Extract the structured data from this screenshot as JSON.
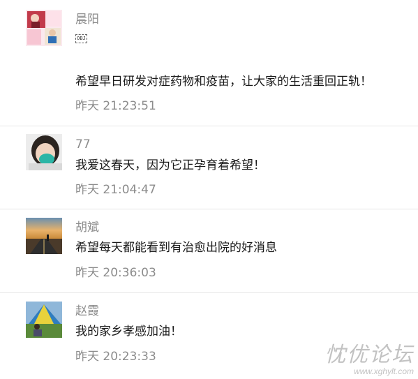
{
  "comments": [
    {
      "name": "晨阳",
      "emoji_glyph": "OBJ",
      "text": "希望早日研发对症药物和疫苗，让大家的生活重回正轨！",
      "time": "昨天 21:23:51",
      "avatar_icon": "collage-photo-avatar"
    },
    {
      "name": "77",
      "text": "我爱这春天，因为它正孕育着希望！",
      "time": "昨天 21:04:47",
      "avatar_icon": "child-with-mask-avatar"
    },
    {
      "name": "胡斌",
      "text": "希望每天都能看到有治愈出院的好消息",
      "time": "昨天 20:36:03",
      "avatar_icon": "road-sunset-avatar"
    },
    {
      "name": "赵霞",
      "text": "我的家乡孝感加油！",
      "time": "昨天 20:23:33",
      "avatar_icon": "tent-outdoor-avatar"
    }
  ],
  "watermark": {
    "title": "忱优论坛",
    "url": "www.xghylt.com"
  }
}
